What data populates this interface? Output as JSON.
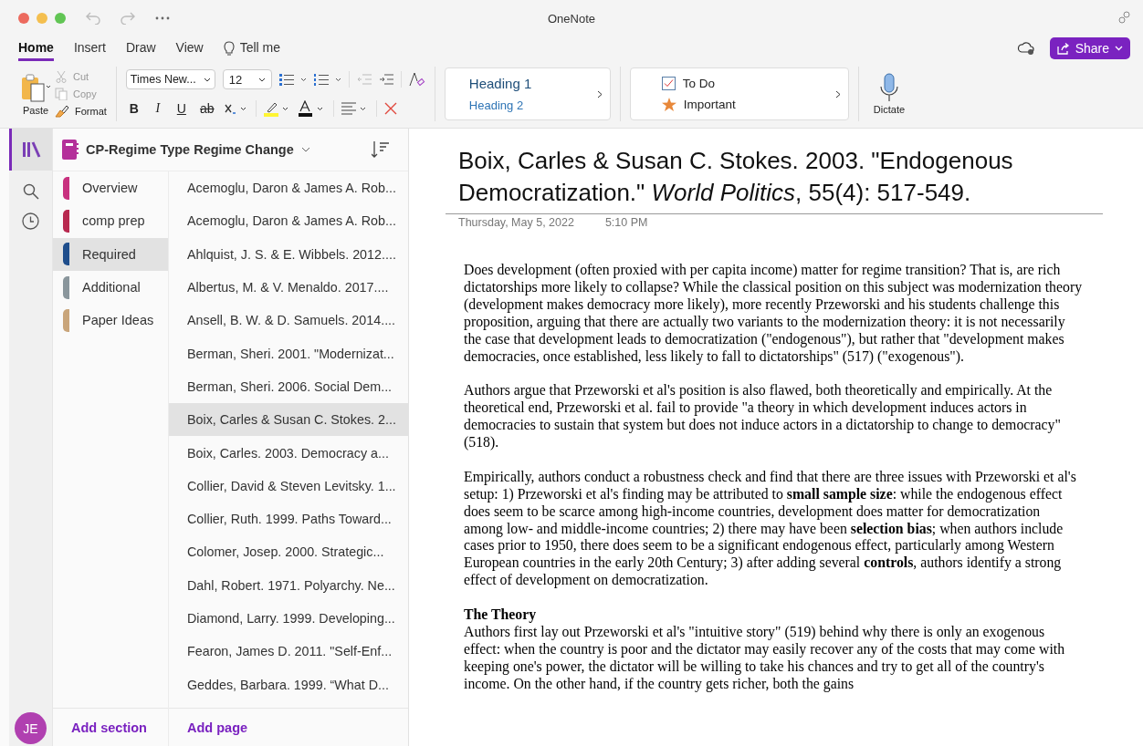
{
  "window": {
    "title": "OneNote"
  },
  "tabs": [
    {
      "label": "Home",
      "selected": true
    },
    {
      "label": "Insert",
      "selected": false
    },
    {
      "label": "Draw",
      "selected": false
    },
    {
      "label": "View",
      "selected": false
    }
  ],
  "tell_me": "Tell me",
  "share": "Share",
  "ribbon": {
    "paste": "Paste",
    "format_buttons": [
      {
        "label": "B",
        "kind": "bold"
      },
      {
        "label": "I",
        "kind": "italic"
      },
      {
        "label": "U",
        "kind": "underline"
      },
      {
        "label": "ab",
        "kind": "strike"
      }
    ],
    "cut": "Cut",
    "copy": "Copy",
    "format": "Format",
    "font_name": "Times New...",
    "font_size": "12",
    "styles": [
      "Heading 1",
      "Heading 2"
    ],
    "tags": [
      {
        "label": "To Do",
        "kind": "todo"
      },
      {
        "label": "Important",
        "kind": "star"
      }
    ],
    "dictate": "Dictate"
  },
  "notebook": {
    "title": "CP-Regime Type Regime Change"
  },
  "sections": [
    {
      "label": "Overview",
      "color": "#c8317f",
      "selected": false
    },
    {
      "label": "comp prep",
      "color": "#b8294f",
      "selected": false
    },
    {
      "label": "Required",
      "color": "#1f4e8c",
      "selected": true
    },
    {
      "label": "Additional",
      "color": "#8a969c",
      "selected": false
    },
    {
      "label": "Paper Ideas",
      "color": "#c9a57a",
      "selected": false
    }
  ],
  "pages": [
    {
      "label": "Acemoglu, Daron & James A. Rob...",
      "selected": false
    },
    {
      "label": "Acemoglu, Daron & James A. Rob...",
      "selected": false
    },
    {
      "label": "Ahlquist, J. S. & E. Wibbels. 2012....",
      "selected": false
    },
    {
      "label": "Albertus, M. & V. Menaldo. 2017....",
      "selected": false
    },
    {
      "label": "Ansell, B. W. & D. Samuels. 2014....",
      "selected": false
    },
    {
      "label": "Berman, Sheri. 2001. \"Modernizat...",
      "selected": false
    },
    {
      "label": "Berman, Sheri. 2006. Social Dem...",
      "selected": false
    },
    {
      "label": "Boix, Carles & Susan C. Stokes. 2...",
      "selected": true
    },
    {
      "label": "Boix, Carles. 2003. Democracy a...",
      "selected": false
    },
    {
      "label": "Collier, David & Steven Levitsky. 1...",
      "selected": false
    },
    {
      "label": "Collier, Ruth. 1999. Paths Toward...",
      "selected": false
    },
    {
      "label": "Colomer, Josep. 2000. Strategic...",
      "selected": false
    },
    {
      "label": "Dahl, Robert. 1971. Polyarchy. Ne...",
      "selected": false
    },
    {
      "label": "Diamond, Larry. 1999. Developing...",
      "selected": false
    },
    {
      "label": "Fearon, James D. 2011. \"Self-Enf...",
      "selected": false
    },
    {
      "label": "Geddes, Barbara. 1999. “What D...",
      "selected": false
    }
  ],
  "add_section": "Add section",
  "add_page": "Add page",
  "user_initials": "JE",
  "note": {
    "title": "Boix, Carles & Susan C. Stokes. 2003. \"Endogenous Democratization.\" *World Politics*, 55(4): 517-549.",
    "date": "Thursday, May 5, 2022",
    "time": "5:10 PM",
    "blocks": [
      {
        "kind": "text",
        "text": "Does development (often proxied with per capita income) matter for regime transition? That is, are rich dictatorships more likely to collapse? While the classical position on this subject was modernization theory (development makes democracy more likely), more recently Przeworski and his students challenge this proposition, arguing that there are actually two variants to the modernization theory: it is not necessarily the case that development leads to democratization (\"endogenous\"), but rather that \"development makes democracies, once established, less likely to fall to dictatorships\" (517) (\"exogenous\")."
      },
      {
        "kind": "text",
        "text": "Authors argue that Przeworski et al's position is also flawed, both theoretically and empirically. At the theoretical end, Przeworski et al. fail to provide \"a theory in which development induces actors in democracies to sustain that system but does not induce actors in a dictatorship to change to democracy\" (518)."
      },
      {
        "kind": "text",
        "text": "Empirically, authors conduct a robustness check and find that there are three issues with Przeworski et al's setup: 1) Przeworski et al's finding may be attributed to **small sample size**: while the endogenous effect does seem to be scarce among high-income countries, development does matter for democratization among low- and middle-income countries; 2) there may have been **selection bias**; when authors include cases prior to 1950, there does seem to be a significant endogenous effect, particularly among Western European countries in the early 20th Century; 3) after adding several **controls**, authors identify a strong effect of development on democratization."
      },
      {
        "kind": "heading",
        "text": "The Theory"
      },
      {
        "kind": "text",
        "text": "Authors first lay out Przeworski et al's \"intuitive story\" (519) behind why there is only an exogenous effect: when the country is poor and the dictator may easily recover any of the costs that may come with keeping one's power, the dictator will be willing to take his chances and try to get all of the country's income. On the other hand, if the country gets richer, both the gains"
      }
    ]
  }
}
